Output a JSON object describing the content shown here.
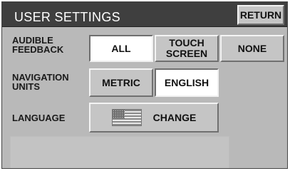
{
  "header": {
    "title": "USER SETTINGS",
    "return_label": "RETURN"
  },
  "settings": {
    "audible_feedback": {
      "label_line1": "AUDIBLE",
      "label_line2": "FEEDBACK",
      "options": [
        {
          "line1": "ALL",
          "line2": "",
          "selected": true
        },
        {
          "line1": "TOUCH",
          "line2": "SCREEN",
          "selected": false
        },
        {
          "line1": "NONE",
          "line2": "",
          "selected": false
        }
      ]
    },
    "navigation_units": {
      "label_line1": "NAVIGATION",
      "label_line2": "UNITS",
      "options": [
        {
          "line1": "METRIC",
          "selected": false
        },
        {
          "line1": "ENGLISH",
          "selected": true
        }
      ]
    },
    "language": {
      "label": "LANGUAGE",
      "flag_icon": "us-flag-icon",
      "change_label": "CHANGE"
    }
  },
  "colors": {
    "title_bar": "#3f3f3f",
    "panel": "#b9b9b9",
    "button": "#c5c5c5",
    "selected_button": "#ffffff"
  }
}
